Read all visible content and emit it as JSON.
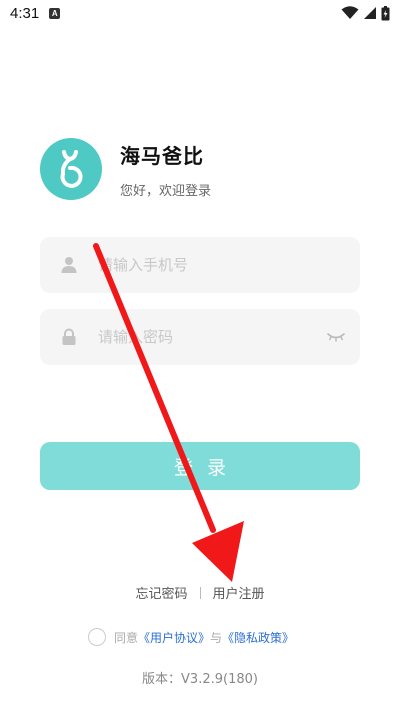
{
  "status_bar": {
    "time": "4:31",
    "notification_glyph": "A"
  },
  "brand": {
    "name": "海马爸比",
    "greeting": "您好，欢迎登录",
    "logo_color": "#4ec9c4"
  },
  "form": {
    "phone_placeholder": "请输入手机号",
    "password_placeholder": "请输入密码",
    "login_label": "登录",
    "login_color": "#7fdcd8"
  },
  "links": {
    "forgot_password": "忘记密码",
    "register": "用户注册"
  },
  "agreement": {
    "prefix": "同意",
    "user_agreement": "《用户协议》",
    "conjunction": "与",
    "privacy_policy": "《隐私政策》",
    "link_color": "#2c6fd1"
  },
  "version": "版本：V3.2.9(180)",
  "annotation": {
    "arrow_color": "#f01818"
  }
}
